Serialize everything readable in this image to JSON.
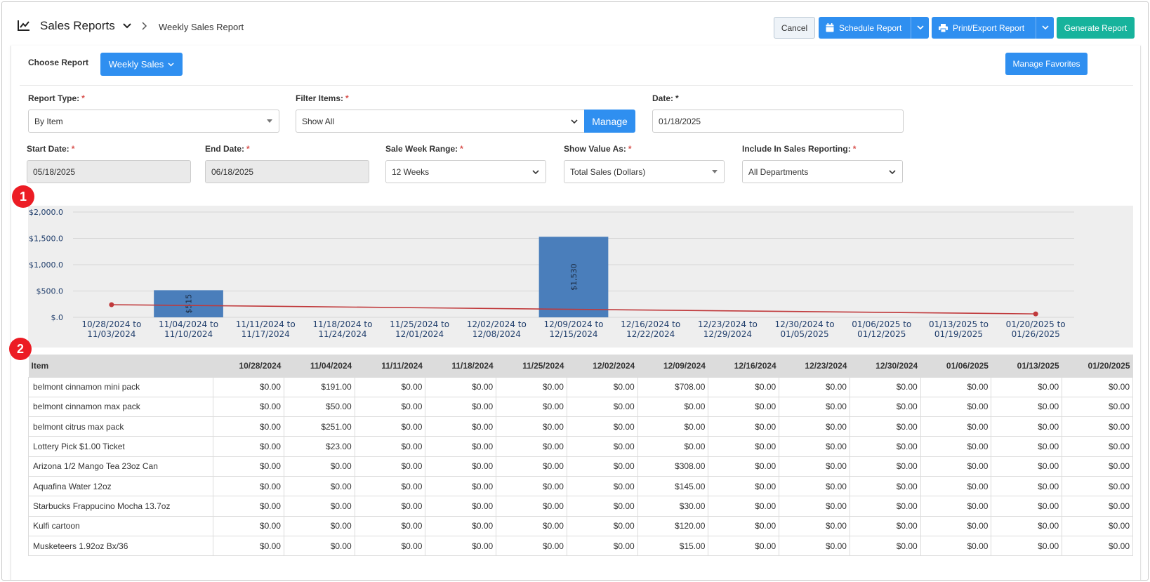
{
  "header": {
    "title": "Sales Reports",
    "breadcrumb": "Weekly Sales Report",
    "cancel_label": "Cancel",
    "schedule_label": "Schedule Report",
    "print_label": "Print/Export Report",
    "generate_label": "Generate Report"
  },
  "controls": {
    "choose_label": "Choose Report",
    "report_button": "Weekly Sales",
    "favorites_label": "Manage Favorites",
    "report_type": {
      "label": "Report Type:",
      "value": "By Item"
    },
    "filter_items": {
      "label": "Filter Items:",
      "value": "Show All",
      "manage_label": "Manage"
    },
    "date": {
      "label": "Date:",
      "value": "01/18/2025"
    },
    "start_date": {
      "label": "Start Date:",
      "value": "05/18/2025"
    },
    "end_date": {
      "label": "End Date:",
      "value": "06/18/2025"
    },
    "week_range": {
      "label": "Sale Week Range:",
      "value": "12 Weeks"
    },
    "show_value": {
      "label": "Show Value As:",
      "value": "Total Sales (Dollars)"
    },
    "include": {
      "label": "Include In Sales Reporting:",
      "value": "All Departments"
    },
    "required_mark": "*"
  },
  "badges": [
    "1",
    "2"
  ],
  "chart_data": {
    "type": "bar",
    "categories": [
      [
        "10/28/2024 to",
        "11/03/2024"
      ],
      [
        "11/04/2024 to",
        "11/10/2024"
      ],
      [
        "11/11/2024 to",
        "11/17/2024"
      ],
      [
        "11/18/2024 to",
        "11/24/2024"
      ],
      [
        "11/25/2024 to",
        "12/01/2024"
      ],
      [
        "12/02/2024 to",
        "12/08/2024"
      ],
      [
        "12/09/2024 to",
        "12/15/2024"
      ],
      [
        "12/16/2024 to",
        "12/22/2024"
      ],
      [
        "12/23/2024 to",
        "12/29/2024"
      ],
      [
        "12/30/2024 to",
        "01/05/2025"
      ],
      [
        "01/06/2025 to",
        "01/12/2025"
      ],
      [
        "01/13/2025 to",
        "01/19/2025"
      ],
      [
        "01/20/2025 to",
        "01/26/2025"
      ]
    ],
    "values": [
      0,
      515,
      0,
      0,
      0,
      0,
      1530,
      0,
      0,
      0,
      0,
      0,
      0
    ],
    "bar_labels": [
      "",
      "$515",
      "",
      "",
      "",
      "",
      "$1,530",
      "",
      "",
      "",
      "",
      "",
      ""
    ],
    "trend": {
      "start": 240,
      "end": 65
    },
    "yticks": [
      "$.0",
      "$500.0",
      "$1,000.0",
      "$1,500.0",
      "$2,000.0"
    ],
    "ylim": [
      0,
      2000
    ],
    "bar_color": "#4a7ebb",
    "trend_color": "#c0393b",
    "grid": true
  },
  "table": {
    "columns": [
      "Item",
      "10/28/2024",
      "11/04/2024",
      "11/11/2024",
      "11/18/2024",
      "11/25/2024",
      "12/02/2024",
      "12/09/2024",
      "12/16/2024",
      "12/23/2024",
      "12/30/2024",
      "01/06/2025",
      "01/13/2025",
      "01/20/2025"
    ],
    "rows": [
      [
        "belmont cinnamon mini pack",
        "$0.00",
        "$191.00",
        "$0.00",
        "$0.00",
        "$0.00",
        "$0.00",
        "$708.00",
        "$0.00",
        "$0.00",
        "$0.00",
        "$0.00",
        "$0.00",
        "$0.00"
      ],
      [
        "belmont cinnamon max pack",
        "$0.00",
        "$50.00",
        "$0.00",
        "$0.00",
        "$0.00",
        "$0.00",
        "$0.00",
        "$0.00",
        "$0.00",
        "$0.00",
        "$0.00",
        "$0.00",
        "$0.00"
      ],
      [
        "belmont citrus max pack",
        "$0.00",
        "$251.00",
        "$0.00",
        "$0.00",
        "$0.00",
        "$0.00",
        "$0.00",
        "$0.00",
        "$0.00",
        "$0.00",
        "$0.00",
        "$0.00",
        "$0.00"
      ],
      [
        "Lottery Pick $1.00 Ticket",
        "$0.00",
        "$23.00",
        "$0.00",
        "$0.00",
        "$0.00",
        "$0.00",
        "$0.00",
        "$0.00",
        "$0.00",
        "$0.00",
        "$0.00",
        "$0.00",
        "$0.00"
      ],
      [
        "Arizona 1/2 Mango Tea 23oz Can",
        "$0.00",
        "$0.00",
        "$0.00",
        "$0.00",
        "$0.00",
        "$0.00",
        "$308.00",
        "$0.00",
        "$0.00",
        "$0.00",
        "$0.00",
        "$0.00",
        "$0.00"
      ],
      [
        "Aquafina Water 12oz",
        "$0.00",
        "$0.00",
        "$0.00",
        "$0.00",
        "$0.00",
        "$0.00",
        "$145.00",
        "$0.00",
        "$0.00",
        "$0.00",
        "$0.00",
        "$0.00",
        "$0.00"
      ],
      [
        "Starbucks Frappucino Mocha 13.7oz",
        "$0.00",
        "$0.00",
        "$0.00",
        "$0.00",
        "$0.00",
        "$0.00",
        "$30.00",
        "$0.00",
        "$0.00",
        "$0.00",
        "$0.00",
        "$0.00",
        "$0.00"
      ],
      [
        "Kulfi cartoon",
        "$0.00",
        "$0.00",
        "$0.00",
        "$0.00",
        "$0.00",
        "$0.00",
        "$120.00",
        "$0.00",
        "$0.00",
        "$0.00",
        "$0.00",
        "$0.00",
        "$0.00"
      ],
      [
        "Musketeers 1.92oz Bx/36",
        "$0.00",
        "$0.00",
        "$0.00",
        "$0.00",
        "$0.00",
        "$0.00",
        "$15.00",
        "$0.00",
        "$0.00",
        "$0.00",
        "$0.00",
        "$0.00",
        "$0.00"
      ]
    ]
  },
  "icons": {
    "header": "chart-line-icon",
    "title_dropdown": "chevron-down-icon",
    "breadcrumb_separator": "chevron-right-icon",
    "schedule": "calendar-icon",
    "print": "printer-icon"
  },
  "colors": {
    "primary": "#2f8ff0",
    "success": "#17b39c",
    "required": "#d9534f",
    "badge": "#ec1c24"
  }
}
